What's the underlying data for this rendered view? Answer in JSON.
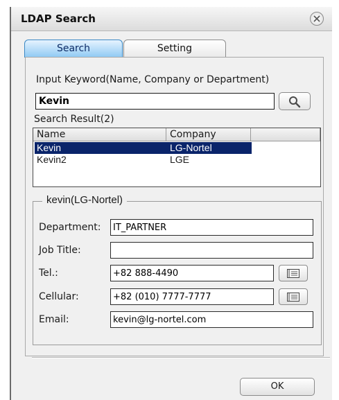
{
  "window": {
    "title": "LDAP Search"
  },
  "tabs": [
    {
      "label": "Search",
      "active": true
    },
    {
      "label": "Setting",
      "active": false
    }
  ],
  "search": {
    "prompt": "Input Keyword(Name, Company or Department)",
    "keyword": "Kevin",
    "result_title": "Search Result(2)"
  },
  "results": {
    "columns": [
      "Name",
      "Company"
    ],
    "rows": [
      {
        "name": "Kevin",
        "company": "LG-Nortel",
        "selected": true
      },
      {
        "name": "Kevin2",
        "company": "LGE",
        "selected": false
      }
    ]
  },
  "detail": {
    "legend": "kevin(LG-Nortel)",
    "department_label": "Department:",
    "department": "IT_PARTNER",
    "job_title_label": "Job Title:",
    "job_title": "",
    "tel_label": "Tel.:",
    "tel": "+82 888-4490",
    "cellular_label": "Cellular:",
    "cellular": "+82 (010) 7777-7777",
    "email_label": "Email:",
    "email": "kevin@lg-nortel.com"
  },
  "footer": {
    "ok_label": "OK"
  },
  "icons": {
    "close": "close-icon",
    "search": "magnifier-icon",
    "address_book": "address-book-icon"
  },
  "colors": {
    "active_tab": "#8ec9f3",
    "selection": "#0a246a",
    "window_bg": "#f0f0f0"
  }
}
